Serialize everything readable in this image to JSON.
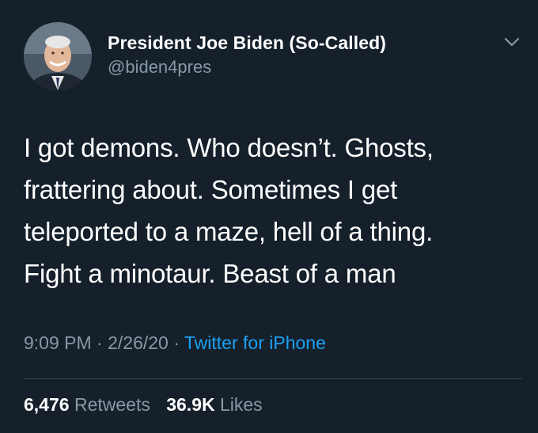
{
  "author": {
    "display_name": "President Joe Biden (So-Called)",
    "handle": "@biden4pres"
  },
  "tweet": {
    "lines": [
      "I got demons. Who doesn’t. Ghosts,",
      "frattering about. Sometimes I get",
      "teleported to a maze, hell of a thing.",
      "Fight a minotaur. Beast of a man"
    ]
  },
  "meta": {
    "time": "9:09 PM",
    "separator": "·",
    "date": "2/26/20",
    "source": "Twitter for iPhone"
  },
  "stats": {
    "retweets_count": "6,476",
    "retweets_label": "Retweets",
    "likes_count": "36.9K",
    "likes_label": "Likes"
  },
  "colors": {
    "background": "#15202b",
    "primary_text": "#ffffff",
    "secondary_text": "#8899a6",
    "accent": "#1da1f2",
    "divider": "#38444d"
  },
  "icons": {
    "avatar": "profile-photo",
    "menu": "chevron-down-icon"
  }
}
